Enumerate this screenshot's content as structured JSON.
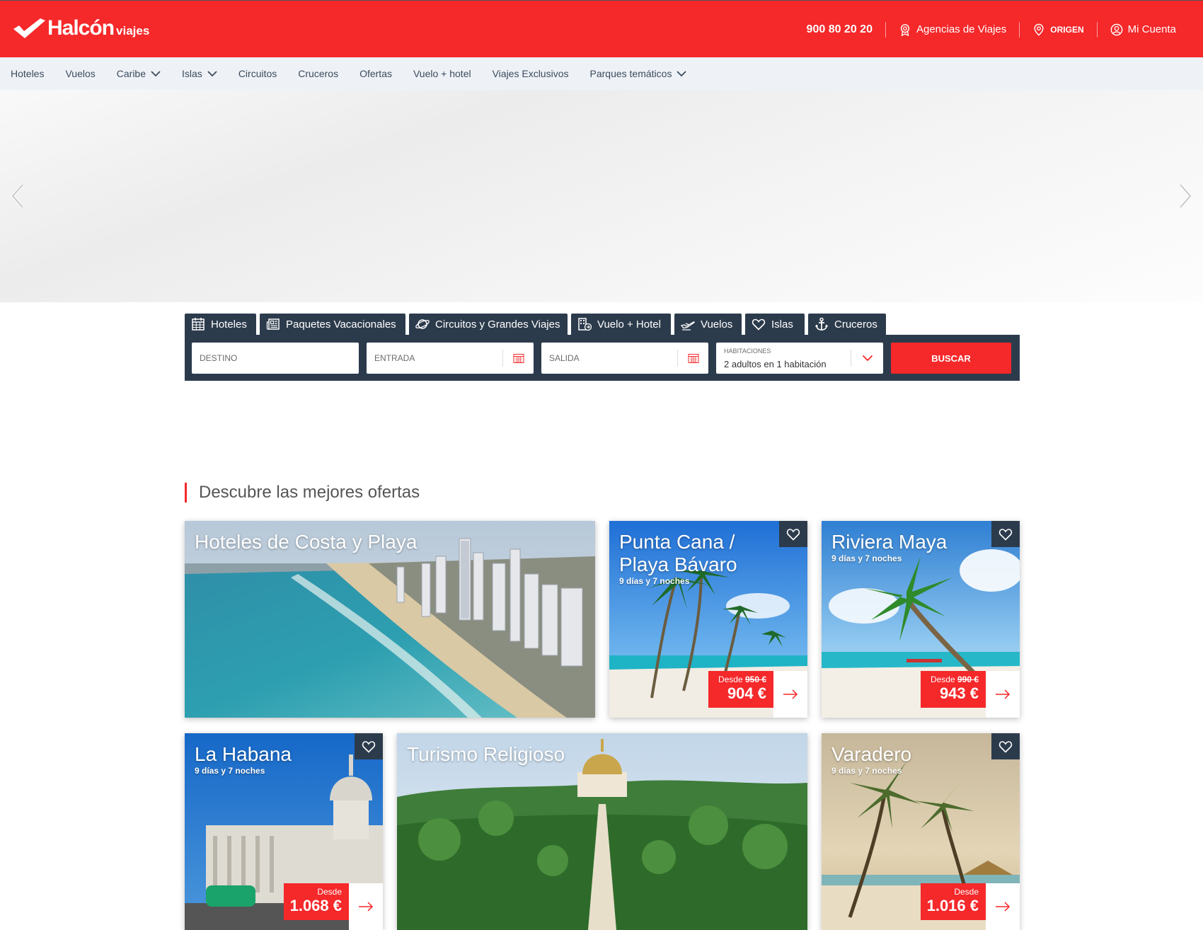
{
  "header": {
    "brand": "Halcón",
    "brand_sub": "viajes",
    "phone": "900 80 20 20",
    "agencies": "Agencias de Viajes",
    "origin": "ORIGEN",
    "account": "Mi Cuenta"
  },
  "nav": {
    "items": [
      {
        "label": "Hoteles"
      },
      {
        "label": "Vuelos"
      },
      {
        "label": "Caribe"
      },
      {
        "label": "Islas"
      },
      {
        "label": "Circuitos"
      },
      {
        "label": "Cruceros"
      },
      {
        "label": "Ofertas"
      },
      {
        "label": "Vuelo + hotel"
      },
      {
        "label": "Viajes Exclusivos"
      },
      {
        "label": "Parques temáticos"
      }
    ]
  },
  "search": {
    "tabs": [
      {
        "label": "Hoteles",
        "icon": "calendar-grid-icon"
      },
      {
        "label": "Paquetes Vacacionales",
        "icon": "newspaper-icon"
      },
      {
        "label": "Circuitos y Grandes Viajes",
        "icon": "planet-icon"
      },
      {
        "label": "Vuelo + Hotel",
        "icon": "building-plane-icon"
      },
      {
        "label": "Vuelos",
        "icon": "plane-icon"
      },
      {
        "label": "Islas",
        "icon": "heart-icon"
      },
      {
        "label": "Cruceros",
        "icon": "anchor-icon"
      }
    ],
    "destino": "DESTINO",
    "entrada": "ENTRADA",
    "salida": "SALIDA",
    "habitaciones_label": "HABITACIONES",
    "habitaciones_value": "2 adultos en 1 habitación",
    "buscar": "BUSCAR"
  },
  "offers": {
    "title": "Descubre las mejores ofertas",
    "cards": [
      {
        "title": "Hoteles de Costa y Playa",
        "subtitle": ""
      },
      {
        "title": "Punta Cana / Playa Bávaro",
        "subtitle": "9 días y 7 noches",
        "desde": "Desde",
        "old_price": "950 €",
        "price": "904 €"
      },
      {
        "title": "Riviera Maya",
        "subtitle": "9 días y 7 noches",
        "desde": "Desde",
        "old_price": "990 €",
        "price": "943 €"
      },
      {
        "title": "La Habana",
        "subtitle": "9 días y 7 noches",
        "desde": "Desde",
        "price": "1.068 €"
      },
      {
        "title": "Turismo Religioso",
        "subtitle": ""
      },
      {
        "title": "Varadero",
        "subtitle": "9 días y 7 noches",
        "desde": "Desde",
        "price": "1.016 €"
      }
    ]
  },
  "colors": {
    "brand_red": "#f5282a",
    "navy": "#2c3b4c",
    "nav_bg": "#eef2f7"
  }
}
